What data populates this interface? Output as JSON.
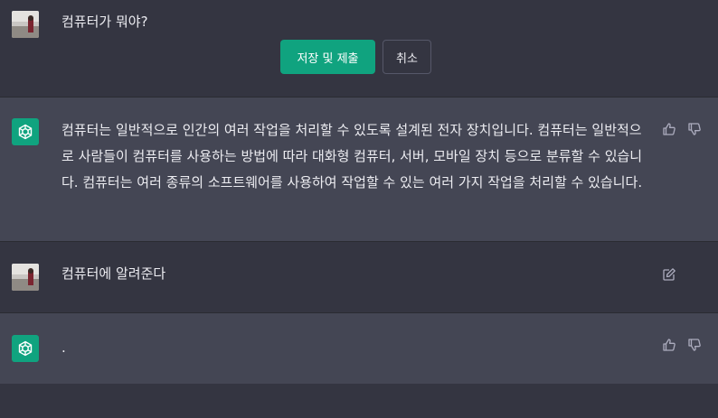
{
  "conversation": {
    "edit_message": {
      "text": "컴퓨터가 뭐야?",
      "save_label": "저장 및 제출",
      "cancel_label": "취소"
    },
    "assistant_reply_1": {
      "text": "컴퓨터는 일반적으로 인간의 여러 작업을 처리할 수 있도록 설계된 전자 장치입니다. 컴퓨터는 일반적으로 사람들이 컴퓨터를 사용하는 방법에 따라 대화형 컴퓨터, 서버, 모바일 장치 등으로 분류할 수 있습니다. 컴퓨터는 여러 종류의 소프트웨어를 사용하여 작업할 수 있는 여러 가지 작업을 처리할 수 있습니다."
    },
    "user_message_2": {
      "text": "컴퓨터에 알려준다"
    },
    "assistant_reply_2": {
      "text": "."
    }
  },
  "icons": {
    "thumbs_up": "thumbs-up-icon",
    "thumbs_down": "thumbs-down-icon",
    "edit": "edit-icon",
    "assistant_logo": "openai-logo-icon"
  },
  "colors": {
    "background": "#343541",
    "assistant_row": "#444654",
    "accent": "#10a37f",
    "text": "#ececf1",
    "icon": "#acacbe"
  }
}
